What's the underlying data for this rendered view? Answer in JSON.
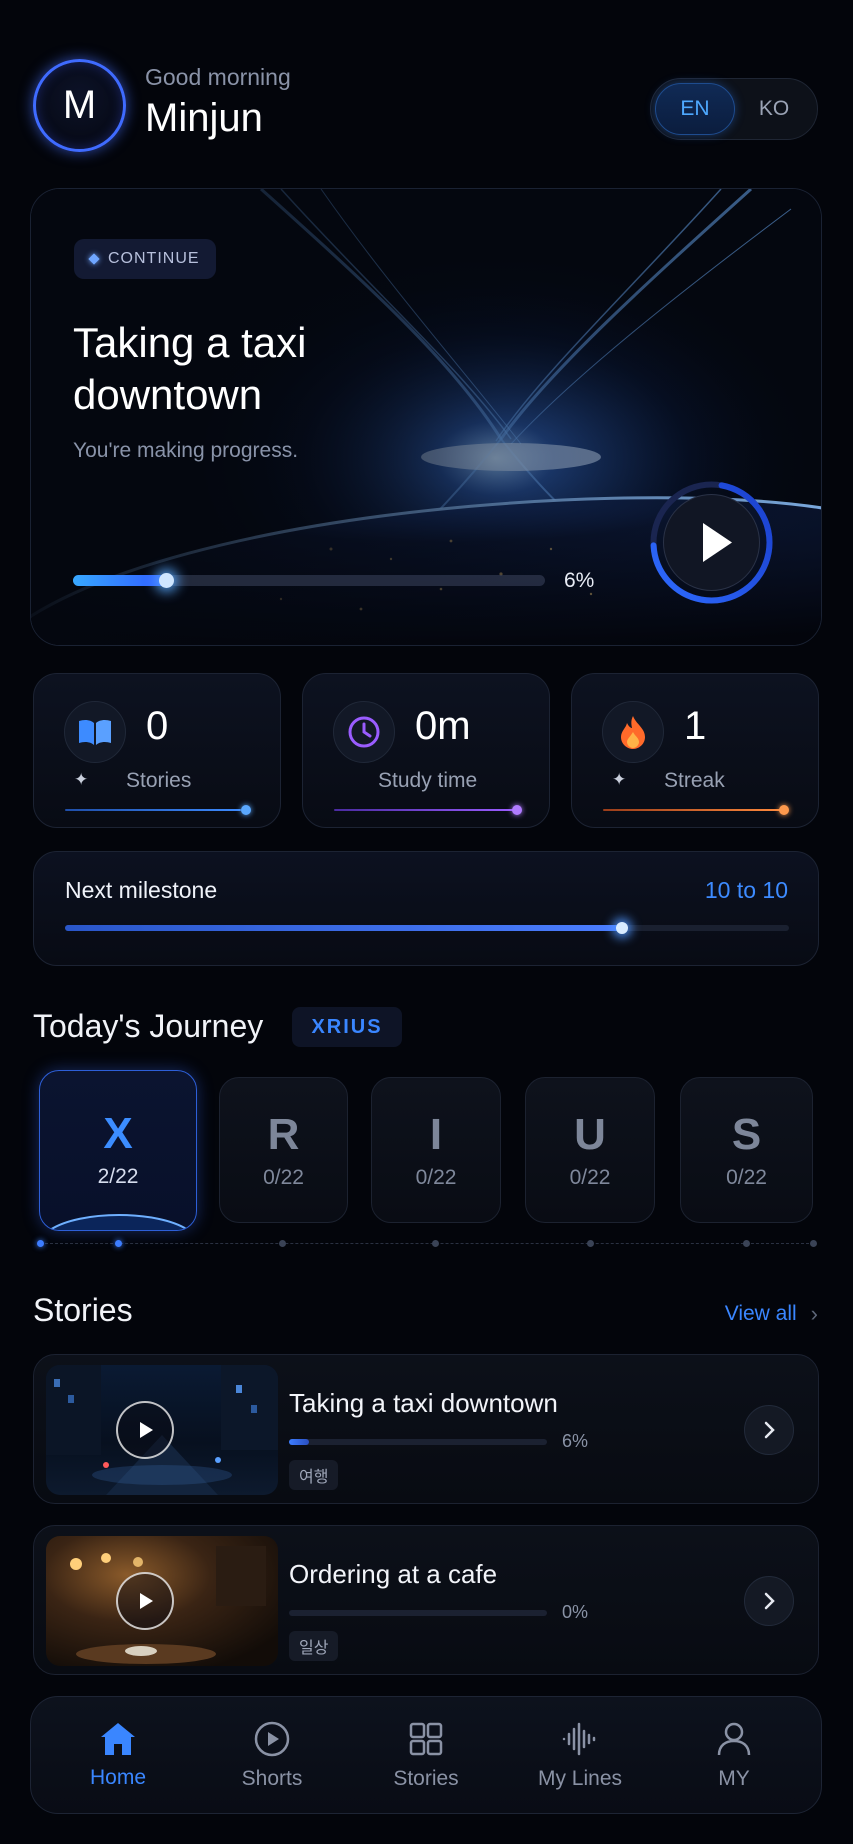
{
  "header": {
    "avatar_initial": "M",
    "greeting": "Good morning",
    "user_name": "Minjun",
    "languages": [
      {
        "code": "EN",
        "active": true
      },
      {
        "code": "KO",
        "active": false
      }
    ]
  },
  "hero": {
    "chip_label": "CONTINUE",
    "title": "Taking a taxi downtown",
    "subtitle": "You're making progress.",
    "progress": 0.06,
    "progress_label": "6%",
    "play_icon": "play-icon"
  },
  "stats": [
    {
      "icon": "book-icon",
      "value": "0",
      "label": "Stories",
      "color": "#3d8bff"
    },
    {
      "icon": "clock-icon",
      "value": "0m",
      "label": "Study time",
      "color": "#9a5cff"
    },
    {
      "icon": "flame-icon",
      "value": "1",
      "label": "Streak",
      "color": "#ff8a3d"
    }
  ],
  "milestone": {
    "label": "Next milestone",
    "value": "10 to 10",
    "progress": 0.77
  },
  "journey": {
    "title": "Today's Journey",
    "badge": "XRIUS",
    "steps": [
      {
        "letter": "X",
        "count": "2/22",
        "active": true
      },
      {
        "letter": "R",
        "count": "0/22",
        "active": false
      },
      {
        "letter": "I",
        "count": "0/22",
        "active": false
      },
      {
        "letter": "U",
        "count": "0/22",
        "active": false
      },
      {
        "letter": "S",
        "count": "0/22",
        "active": false
      }
    ]
  },
  "stories": {
    "title": "Stories",
    "view_all": "View all",
    "items": [
      {
        "title": "Taking a taxi downtown",
        "progress": 0.06,
        "progress_label": "6%",
        "tag": "여행"
      },
      {
        "title": "Ordering at a cafe",
        "progress": 0.0,
        "progress_label": "0%",
        "tag": "일상"
      }
    ]
  },
  "nav": {
    "items": [
      {
        "label": "Home",
        "icon": "home-icon",
        "active": true
      },
      {
        "label": "Shorts",
        "icon": "play-circle-icon",
        "active": false
      },
      {
        "label": "Stories",
        "icon": "grid-icon",
        "active": false
      },
      {
        "label": "My Lines",
        "icon": "waveform-icon",
        "active": false
      },
      {
        "label": "MY",
        "icon": "person-icon",
        "active": false
      }
    ]
  },
  "colors": {
    "accent": "#3a86ff",
    "background": "#03050b"
  }
}
